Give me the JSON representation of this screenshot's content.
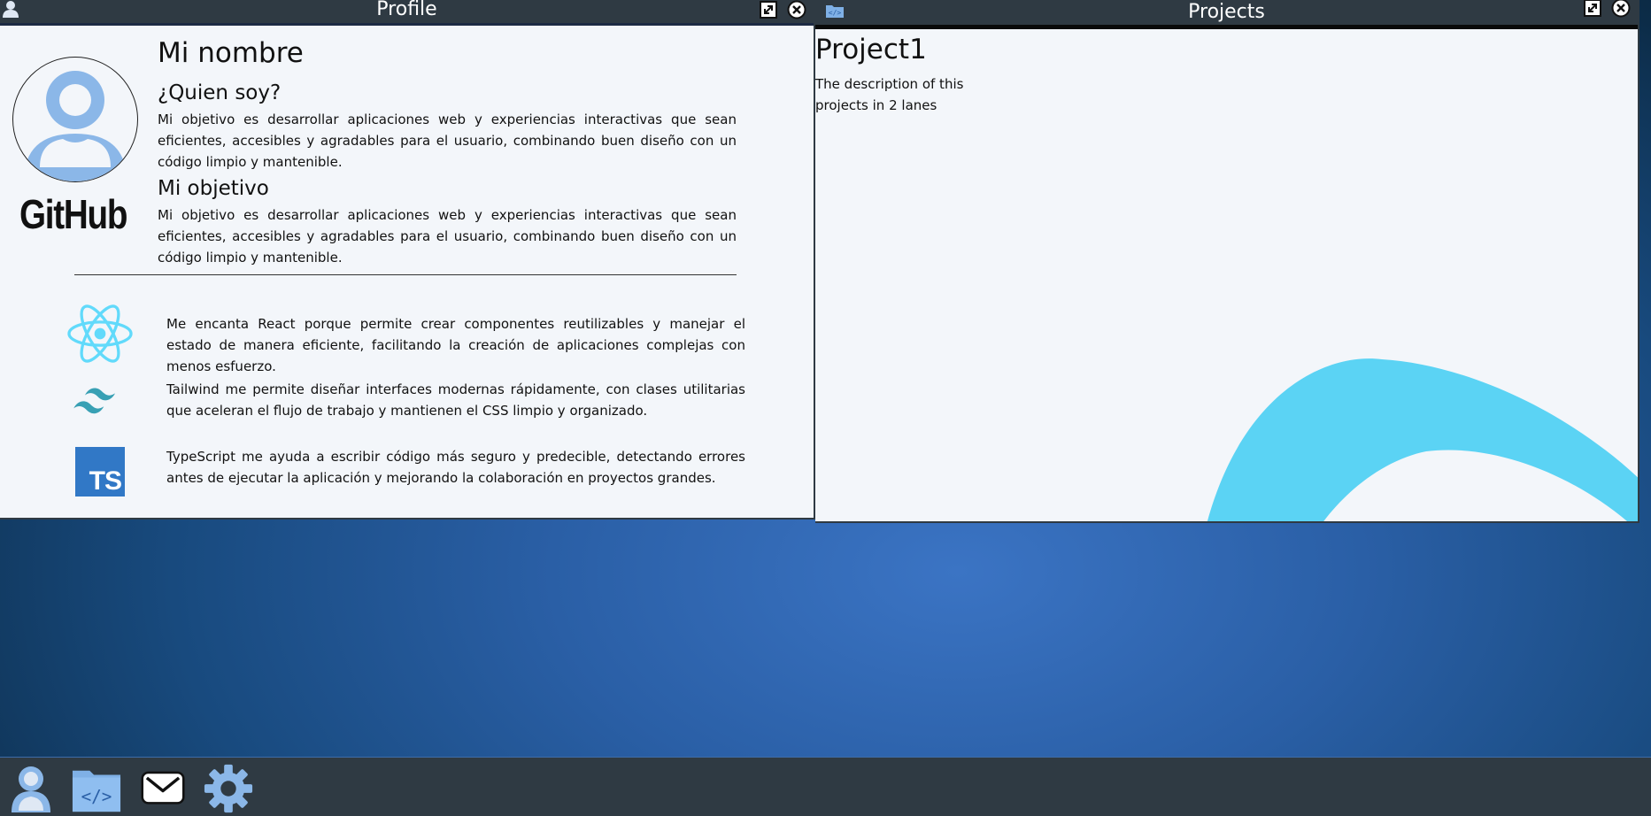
{
  "profile_window": {
    "title": "Profile",
    "name": "Mi nombre",
    "github_label": "GitHub",
    "about": {
      "heading": "¿Quien soy?",
      "text": "Mi objetivo es desarrollar aplicaciones web y experiencias interactivas que sean eficientes, accesibles y agradables para el usuario, combinando buen diseño con un código limpio y mantenible."
    },
    "goal": {
      "heading": "Mi objetivo",
      "text": "Mi objetivo es desarrollar aplicaciones web y experiencias interactivas que sean eficientes, accesibles y agradables para el usuario, combinando buen diseño con un código limpio y mantenible."
    },
    "tech": [
      {
        "icon": "react-icon",
        "text": "Me encanta React porque permite crear componentes reutilizables y manejar el estado de manera eficiente, facilitando la creación de aplicaciones complejas con menos esfuerzo."
      },
      {
        "icon": "tailwind-icon",
        "text": "Tailwind me permite diseñar interfaces modernas rápidamente, con clases utilitarias que aceleran el flujo de trabajo y mantienen el CSS limpio y organizado."
      },
      {
        "icon": "typescript-icon",
        "label": "TS",
        "text": "TypeScript me ayuda a escribir código más seguro y predecible, detectando errores antes de ejecutar la aplicación y mejorando la colaboración en proyectos grandes."
      }
    ]
  },
  "projects_window": {
    "title": "Projects",
    "project_title": "Project1",
    "project_description": "The description of this projects in 2 lanes"
  },
  "taskbar": {
    "items": [
      "profile-icon",
      "projects-folder-icon",
      "mail-icon",
      "settings-gear-icon"
    ]
  },
  "colors": {
    "titlebar": "#2f3a43",
    "window_bg": "#f3f6fa",
    "accent_blue": "#7fb0e6",
    "react": "#61dafb",
    "tailwind": "#38a0b4",
    "typescript": "#3178c6"
  }
}
